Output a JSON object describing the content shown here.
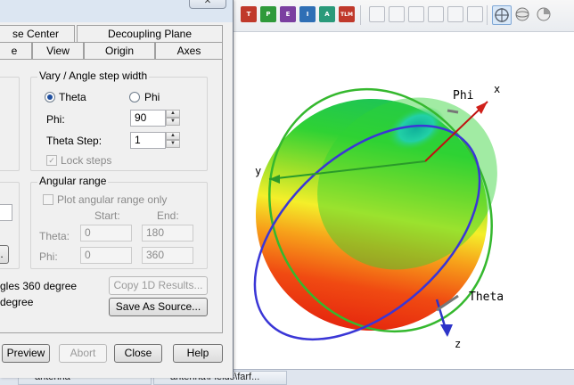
{
  "dialog": {
    "close_glyph": "✕",
    "tabs_row1": [
      "se Center",
      "Decoupling Plane"
    ],
    "tabs_row2": [
      "e",
      "View",
      "Origin",
      "Axes"
    ],
    "vary_group": {
      "title": "Vary / Angle step width",
      "option_theta": "Theta",
      "option_phi": "Phi",
      "selected": "Theta",
      "phi_label": "Phi:",
      "phi_value": "90",
      "theta_step_label": "Theta Step:",
      "theta_step_value": "1",
      "lock_steps_label": "Lock steps",
      "lock_steps_checked": true
    },
    "angular_group": {
      "title": "Angular range",
      "plot_range_label": "Plot angular range only",
      "plot_range_checked": false,
      "start_header": "Start:",
      "end_header": "End:",
      "theta_label": "Theta:",
      "theta_start": "0",
      "theta_end": "180",
      "phi_label": "Phi:",
      "phi_start": "0",
      "phi_end": "360"
    },
    "left_text_1": "gles 360 degree",
    "left_text_2": "degree",
    "left_button_glyph": ".",
    "copy_results_label": "Copy 1D Results...",
    "save_source_label": "Save As Source...",
    "footer": {
      "preview": "Preview",
      "abort": "Abort",
      "close": "Close",
      "help": "Help"
    }
  },
  "toolbar": {
    "colored_buttons": [
      {
        "label": "T",
        "color": "#c0392b"
      },
      {
        "label": "P",
        "color": "#2f9a3a"
      },
      {
        "label": "E",
        "color": "#7b3fa0"
      },
      {
        "label": "I",
        "color": "#2f6fb5"
      },
      {
        "label": "A",
        "color": "#2a9a7a"
      },
      {
        "label": "TLM",
        "color": "#c0392b"
      }
    ]
  },
  "plot3d": {
    "axis_phi_label": "Phi",
    "axis_theta_label": "Theta",
    "axis_x_label": "x",
    "axis_y_label": "y",
    "axis_z_label": "z"
  },
  "taskbar": {
    "task1": "antenna",
    "task2": "antenna\\Fields\\farf..."
  }
}
